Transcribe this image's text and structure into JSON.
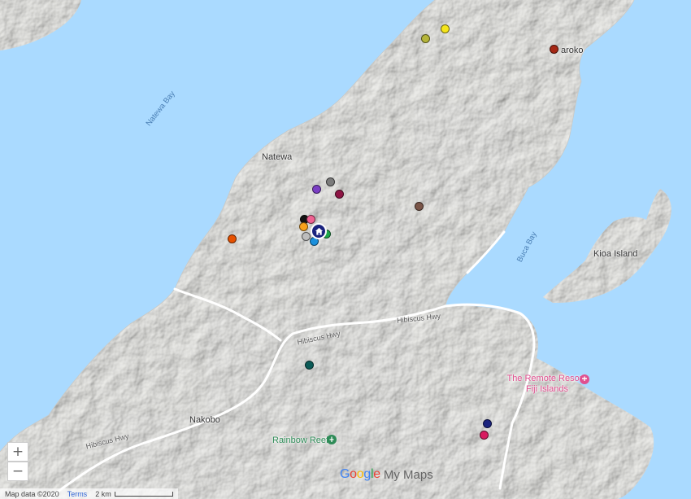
{
  "map": {
    "water_labels": {
      "natewa_bay": "Natewa Bay",
      "buca_bay": "Buca Bay"
    },
    "place_labels": {
      "natewa": "Natewa",
      "saroko": "aroko",
      "kioa": "Kioa Island",
      "nakobo": "Nakobo"
    },
    "road_labels": {
      "hibiscus_1": "Hibiscus Hwy",
      "hibiscus_2": "Hibiscus Hwy",
      "hibiscus_3": "Hibiscus Hwy"
    },
    "poi": {
      "resort": "The Remote Resort, Fiji Islands",
      "reef": "Rainbow Reef"
    },
    "colors": {
      "water": "#aadaff",
      "land": "#e6e6e4",
      "home_marker": "#1a237e"
    },
    "markers": [
      {
        "name": "olive",
        "color": "#b5b53a"
      },
      {
        "name": "yellow",
        "color": "#f5e51a"
      },
      {
        "name": "dark-red",
        "color": "#a52714"
      },
      {
        "name": "gray",
        "color": "#7b7b7b"
      },
      {
        "name": "purple",
        "color": "#7b3fc4"
      },
      {
        "name": "maroon",
        "color": "#8e1444"
      },
      {
        "name": "brown",
        "color": "#7a5548"
      },
      {
        "name": "black",
        "color": "#111111"
      },
      {
        "name": "pink",
        "color": "#f06292"
      },
      {
        "name": "orange",
        "color": "#f7a11b"
      },
      {
        "name": "light-gray",
        "color": "#bdbdbd"
      },
      {
        "name": "green",
        "color": "#1fa64b"
      },
      {
        "name": "blue",
        "color": "#1a8fdc"
      },
      {
        "name": "deep-orange",
        "color": "#e65100"
      },
      {
        "name": "teal",
        "color": "#0b5b57"
      },
      {
        "name": "navy",
        "color": "#1a237e"
      },
      {
        "name": "magenta",
        "color": "#d81b60"
      }
    ],
    "home_icon": "home-icon"
  },
  "controls": {
    "zoom_in": "+",
    "zoom_out": "−"
  },
  "footer": {
    "attribution": "Map data ©2020",
    "terms": "Terms",
    "scale": "2 km"
  },
  "logo": {
    "google": "Google",
    "my_maps": "My Maps"
  }
}
